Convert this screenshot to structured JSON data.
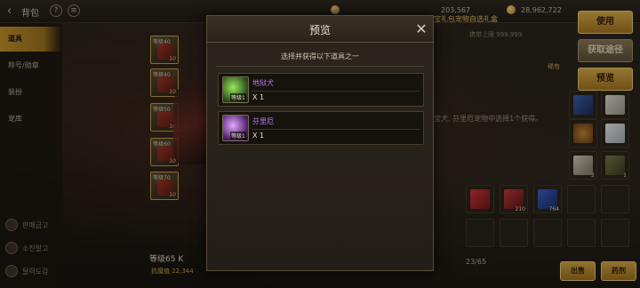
{
  "topbar": {
    "title": "背包",
    "currency_1": "203,567",
    "currency_2": "28,962,722"
  },
  "sidebar": {
    "items": [
      {
        "label": "道具"
      },
      {
        "label": "称号/勋章"
      },
      {
        "label": "装扮"
      },
      {
        "label": "宠库"
      }
    ],
    "bottom": [
      {
        "label": "판매금고"
      },
      {
        "label": "소진알고"
      },
      {
        "label": "탈력도감"
      }
    ]
  },
  "slots": [
    {
      "tag": "等级40",
      "count": "10"
    },
    {
      "tag": "等级40",
      "count": "10"
    },
    {
      "tag": "等级50",
      "count": "10"
    },
    {
      "tag": "等级60",
      "count": "10"
    },
    {
      "tag": "等级70",
      "count": "10"
    }
  ],
  "character": {
    "level": "等级65 K",
    "power": "抗魔值 22,344"
  },
  "right_panel": {
    "item_title": "宝礼包宠物自选礼盒",
    "price_label": "携带上限",
    "price": "999,999",
    "rarity": "稀有",
    "description": "宝犬, 芬里厄宠物中选择1个获得。",
    "buttons": {
      "use": "使用",
      "source": "获取途径",
      "preview": "预览"
    },
    "inventory_count": "23/65",
    "cells": [
      {
        "count": ""
      },
      {
        "count": ""
      },
      {
        "count": "2"
      },
      {
        "count": "1"
      },
      {
        "count": "210"
      },
      {
        "count": "764"
      }
    ],
    "bottom_buttons": {
      "sell": "出售",
      "decompose": "药剂"
    }
  },
  "modal": {
    "title": "预览",
    "subtitle": "选择并获得以下道具之一",
    "rewards": [
      {
        "name": "地狱犬",
        "level": "等级1",
        "qty": "X 1",
        "color": "#5ed15a"
      },
      {
        "name": "芬里厄",
        "level": "等级1",
        "qty": "X 1",
        "color": "#b46be0"
      }
    ]
  }
}
